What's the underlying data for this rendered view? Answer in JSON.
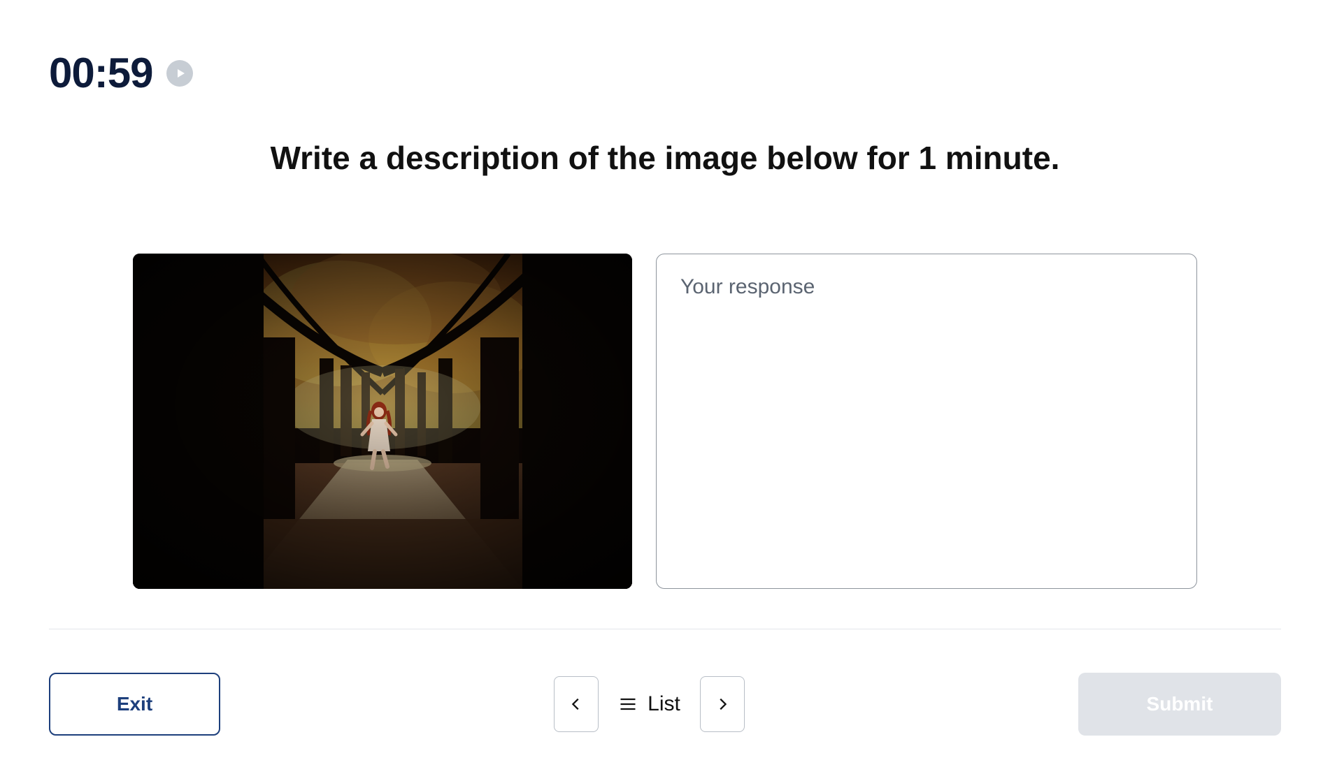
{
  "timer": {
    "display": "00:59"
  },
  "prompt": "Write a description of the image below for 1 minute.",
  "image": {
    "description": "forest-autumn-girl-running"
  },
  "response": {
    "placeholder": "Your response",
    "value": ""
  },
  "footer": {
    "exit_label": "Exit",
    "list_label": "List",
    "submit_label": "Submit"
  }
}
